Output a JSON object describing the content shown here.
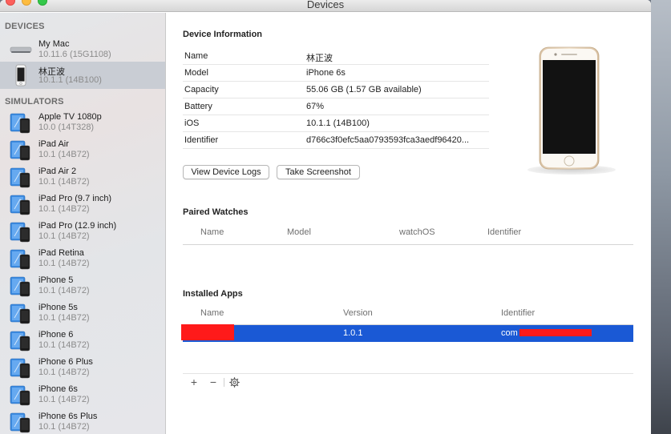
{
  "window": {
    "title": "Devices"
  },
  "sidebar": {
    "devices_header": "DEVICES",
    "simulators_header": "SIMULATORS",
    "devices": [
      {
        "name": "My Mac",
        "sub": "10.11.6 (15G1108)",
        "icon": "mac-mini-icon"
      },
      {
        "name": "林正波",
        "sub": "10.1.1 (14B100)",
        "icon": "iphone-device-icon"
      }
    ],
    "simulators": [
      {
        "name": "Apple TV 1080p",
        "sub": "10.0 (14T328)"
      },
      {
        "name": "iPad Air",
        "sub": "10.1 (14B72)"
      },
      {
        "name": "iPad Air 2",
        "sub": "10.1 (14B72)"
      },
      {
        "name": "iPad Pro (9.7 inch)",
        "sub": "10.1 (14B72)"
      },
      {
        "name": "iPad Pro (12.9 inch)",
        "sub": "10.1 (14B72)"
      },
      {
        "name": "iPad Retina",
        "sub": "10.1 (14B72)"
      },
      {
        "name": "iPhone 5",
        "sub": "10.1 (14B72)"
      },
      {
        "name": "iPhone 5s",
        "sub": "10.1 (14B72)"
      },
      {
        "name": "iPhone 6",
        "sub": "10.1 (14B72)"
      },
      {
        "name": "iPhone 6 Plus",
        "sub": "10.1 (14B72)"
      },
      {
        "name": "iPhone 6s",
        "sub": "10.1 (14B72)"
      },
      {
        "name": "iPhone 6s Plus",
        "sub": "10.1 (14B72)"
      }
    ]
  },
  "device_info": {
    "title": "Device Information",
    "rows": [
      {
        "key": "Name",
        "value": "林正波"
      },
      {
        "key": "Model",
        "value": "iPhone 6s"
      },
      {
        "key": "Capacity",
        "value": "55.06 GB (1.57 GB available)"
      },
      {
        "key": "Battery",
        "value": "67%"
      },
      {
        "key": "iOS",
        "value": "10.1.1 (14B100)"
      },
      {
        "key": "Identifier",
        "value": "d766c3f0efc5aa0793593fca3aedf96420..."
      }
    ],
    "view_logs_label": "View Device Logs",
    "screenshot_label": "Take Screenshot"
  },
  "paired_watches": {
    "title": "Paired Watches",
    "columns": [
      "Name",
      "Model",
      "watchOS",
      "Identifier"
    ]
  },
  "installed_apps": {
    "title": "Installed Apps",
    "columns": [
      "Name",
      "Version",
      "Identifier"
    ],
    "rows": [
      {
        "name": "",
        "version": "1.0.1",
        "identifier": "com"
      }
    ]
  },
  "bottom_toolbar": {
    "add": "+",
    "remove": "−"
  },
  "colors": {
    "selection": "#1a59d5",
    "redaction": "#ff1a1a",
    "sidebar_selected": "#c9cdd4"
  }
}
